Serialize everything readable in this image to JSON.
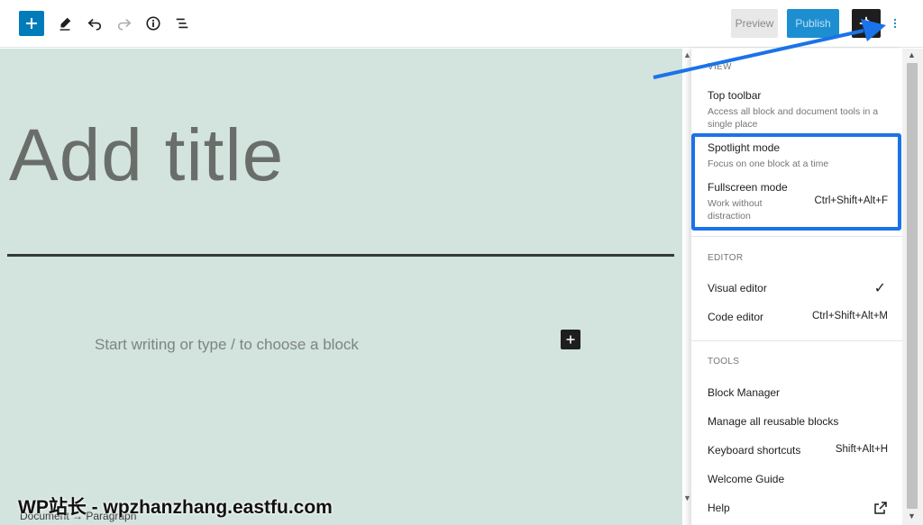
{
  "toolbar": {
    "icons": [
      "plus-icon",
      "pencil-icon",
      "undo-icon",
      "redo-icon",
      "info-icon",
      "list-view-icon"
    ],
    "preview_label": "Preview",
    "publish_label": "Publish",
    "accent": "#007cba"
  },
  "editor": {
    "title_placeholder": "Add title",
    "paragraph_placeholder": "Start writing or type / to choose a block",
    "breadcrumb": "Document → Paragraph",
    "background": "#d3e3dd"
  },
  "menu": {
    "view": {
      "label": "VIEW",
      "items": [
        {
          "label": "Top toolbar",
          "desc": "Access all block and document tools in a single place"
        },
        {
          "label": "Spotlight mode",
          "desc": "Focus on one block at a time"
        },
        {
          "label": "Fullscreen mode",
          "desc": "Work without distraction",
          "shortcut": "Ctrl+Shift+Alt+F"
        }
      ]
    },
    "editor": {
      "label": "EDITOR",
      "items": [
        {
          "label": "Visual editor",
          "check": "✓"
        },
        {
          "label": "Code editor",
          "shortcut": "Ctrl+Shift+Alt+M"
        }
      ]
    },
    "tools": {
      "label": "TOOLS",
      "items": [
        {
          "label": "Block Manager"
        },
        {
          "label": "Manage all reusable blocks"
        },
        {
          "label": "Keyboard shortcuts",
          "shortcut": "Shift+Alt+H"
        },
        {
          "label": "Welcome Guide"
        },
        {
          "label": "Help"
        }
      ]
    }
  },
  "watermark": "WP站长 - wpzhanzhang.eastfu.com",
  "annotation_color": "#1a73e8"
}
